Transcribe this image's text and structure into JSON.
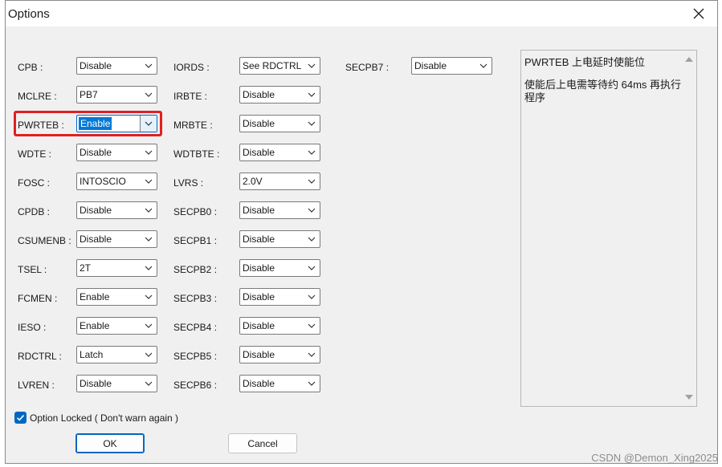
{
  "window": {
    "title": "Options"
  },
  "columns": [
    {
      "rows": [
        {
          "label": "CPB :",
          "value": "Disable"
        },
        {
          "label": "MCLRE :",
          "value": "PB7"
        },
        {
          "label": "PWRTEB :",
          "value": "Enable",
          "focused": true
        },
        {
          "label": "WDTE :",
          "value": "Disable"
        },
        {
          "label": "FOSC :",
          "value": "INTOSCIO"
        },
        {
          "label": "CPDB :",
          "value": "Disable"
        },
        {
          "label": "CSUMENB :",
          "value": "Disable"
        },
        {
          "label": "TSEL :",
          "value": "2T"
        },
        {
          "label": "FCMEN :",
          "value": "Enable"
        },
        {
          "label": "IESO :",
          "value": "Enable"
        },
        {
          "label": "RDCTRL :",
          "value": "Latch"
        },
        {
          "label": "LVREN :",
          "value": "Disable"
        }
      ]
    },
    {
      "rows": [
        {
          "label": "IORDS :",
          "value": "See RDCTRL"
        },
        {
          "label": "IRBTE :",
          "value": "Disable"
        },
        {
          "label": "MRBTE :",
          "value": "Disable"
        },
        {
          "label": "WDTBTE :",
          "value": "Disable"
        },
        {
          "label": "LVRS :",
          "value": "2.0V"
        },
        {
          "label": "SECPB0 :",
          "value": "Disable"
        },
        {
          "label": "SECPB1 :",
          "value": "Disable"
        },
        {
          "label": "SECPB2 :",
          "value": "Disable"
        },
        {
          "label": "SECPB3 :",
          "value": "Disable"
        },
        {
          "label": "SECPB4 :",
          "value": "Disable"
        },
        {
          "label": "SECPB5 :",
          "value": "Disable"
        },
        {
          "label": "SECPB6 :",
          "value": "Disable"
        }
      ]
    },
    {
      "rows": [
        {
          "label": "SECPB7 :",
          "value": "Disable"
        }
      ]
    }
  ],
  "description": {
    "title": "PWRTEB 上电延时使能位",
    "body": "使能后上电需等待约 64ms 再执行程序"
  },
  "option_locked": {
    "label": "Option Locked ( Don't warn again )",
    "checked": true
  },
  "buttons": {
    "ok": "OK",
    "cancel": "Cancel"
  },
  "watermark": "CSDN @Demon_Xing2025",
  "colors": {
    "accent": "#0067c0",
    "highlight_box": "#e02020",
    "selection": "#0078d7"
  }
}
